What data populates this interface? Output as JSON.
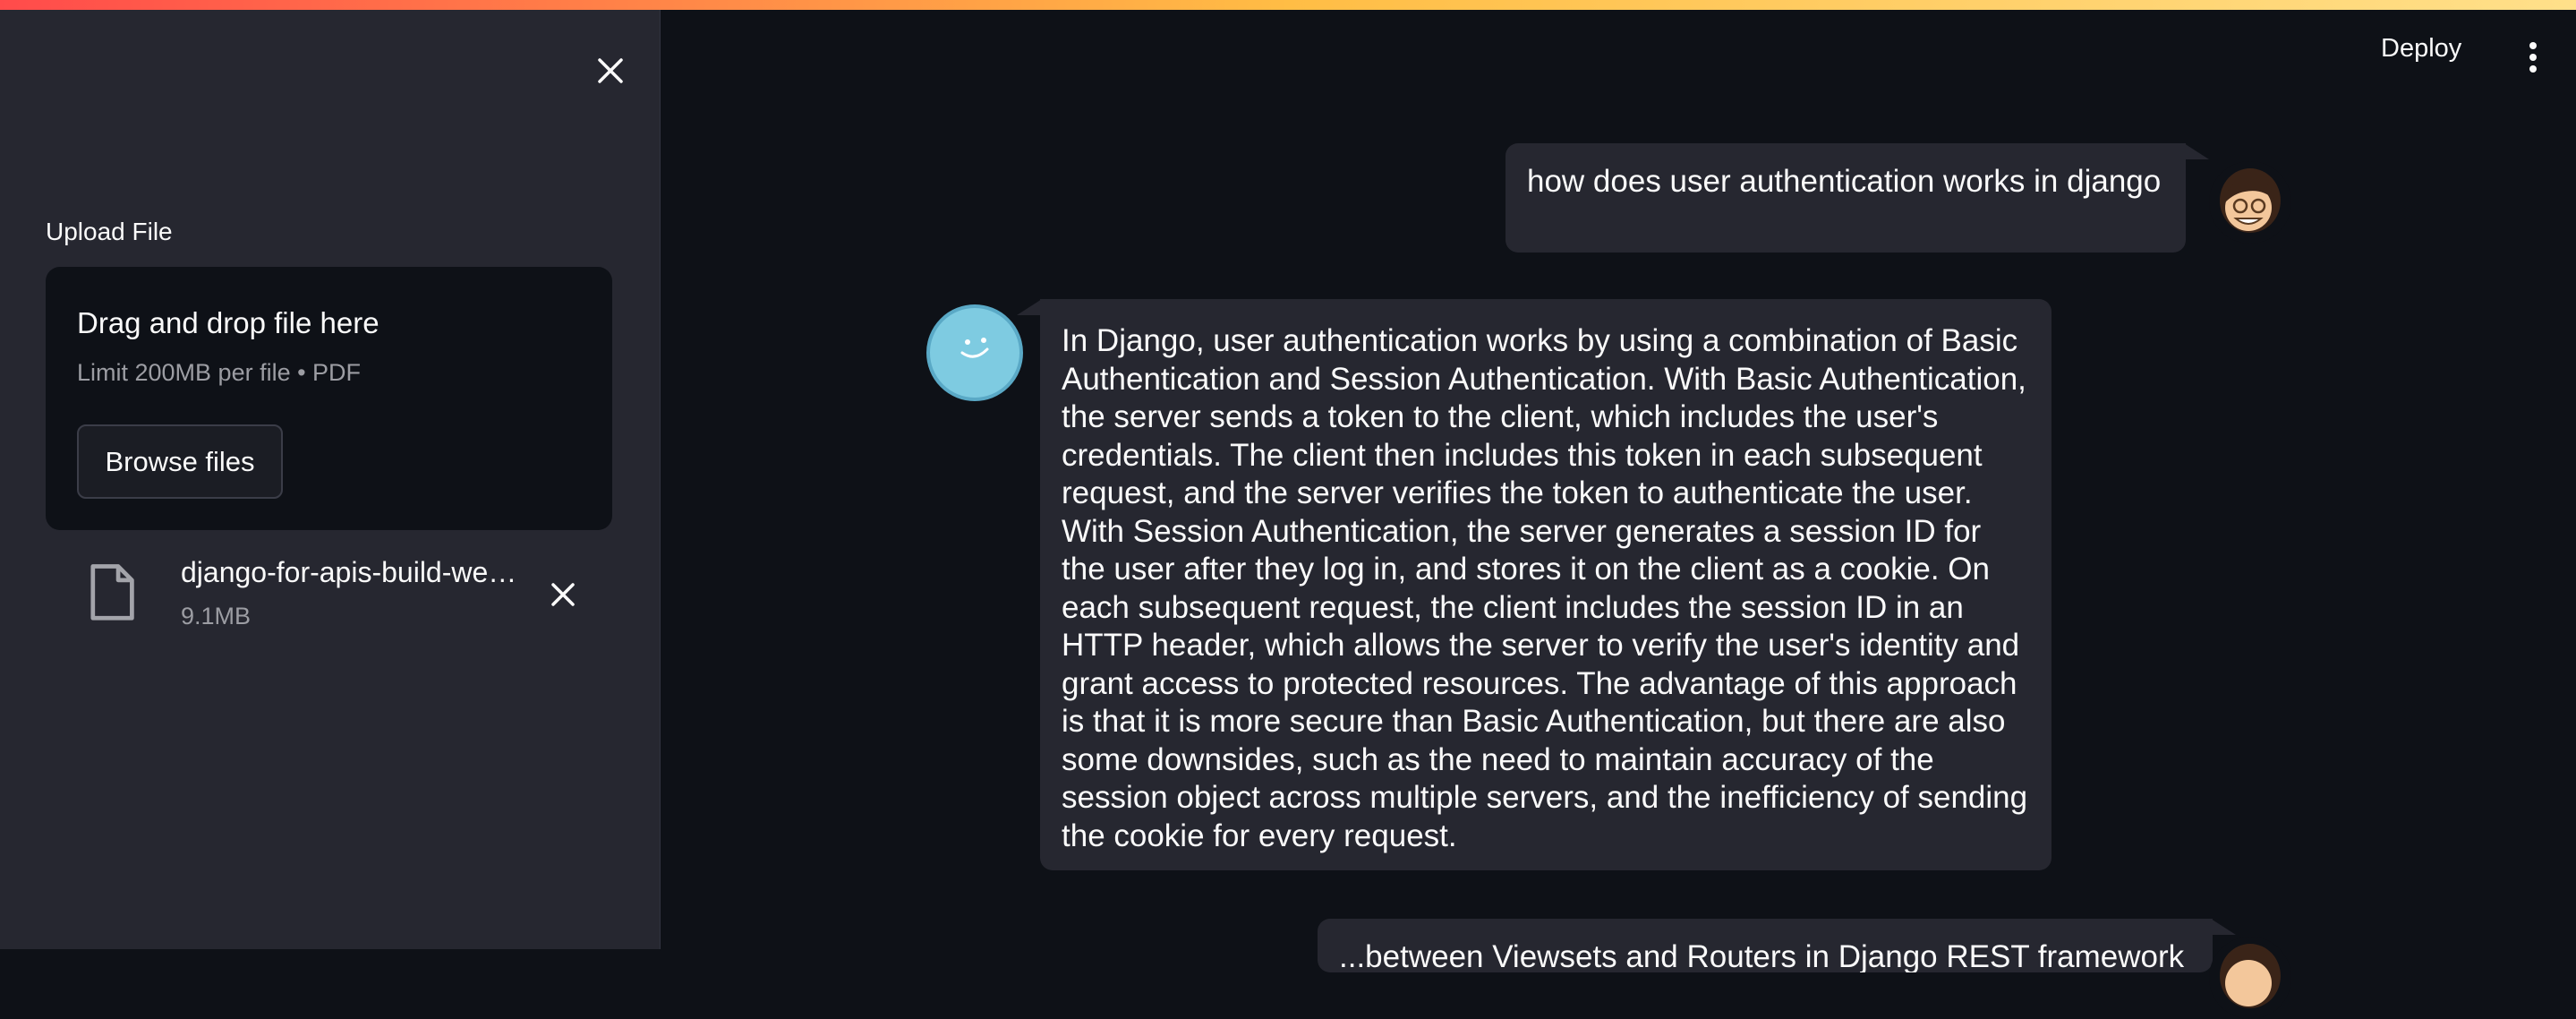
{
  "sidebar": {
    "upload_label": "Upload File",
    "dropzone": {
      "title": "Drag and drop file here",
      "limit": "Limit 200MB per file • PDF",
      "browse_label": "Browse files"
    },
    "file": {
      "name": "django-for-apis-build-we…",
      "size": "9.1MB",
      "icon": "file-icon"
    }
  },
  "header": {
    "deploy_label": "Deploy",
    "menu_icon": "kebab-menu-icon"
  },
  "chat": {
    "messages": [
      {
        "role": "user",
        "text": "how does user authentication works in django"
      },
      {
        "role": "assistant",
        "text": "In Django, user authentication works by using a combination of Basic Authentication and Session Authentication. With Basic Authentication, the server sends a token to the client, which includes the user's credentials. The client then includes this token in each subsequent request, and the server verifies the token to authenticate the user. With Session Authentication, the server generates a session ID for the user after they log in, and stores it on the client as a cookie. On each subsequent request, the client includes the session ID in an HTTP header, which allows the server to verify the user's identity and grant access to protected resources. The advantage of this approach is that it is more secure than Basic Authentication, but there are also some downsides, such as the need to maintain accuracy of the session object across multiple servers, and the inefficiency of sending the cookie for every request."
      },
      {
        "role": "user",
        "text": "...between Viewsets and Routers in Django REST framework"
      }
    ]
  },
  "colors": {
    "background": "#0e1117",
    "sidebar": "#262730",
    "bubble": "#262730",
    "accent_start": "#ff4b4b",
    "accent_end": "#ffe08a",
    "bot_avatar": "#7ecbe1"
  }
}
